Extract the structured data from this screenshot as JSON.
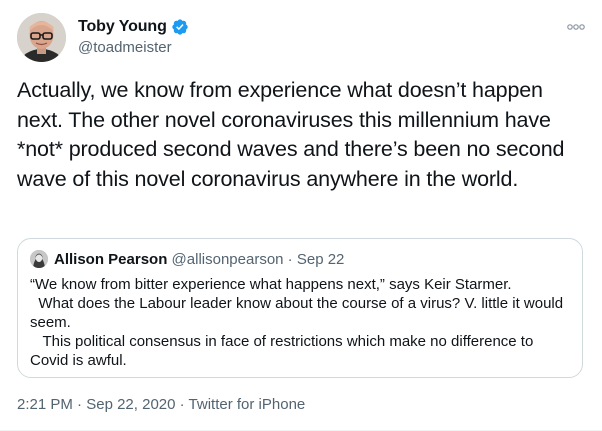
{
  "author": {
    "display_name": "Toby Young",
    "handle": "@toadmeister",
    "verified": true
  },
  "tweet": {
    "text": "Actually, we know from experience what doesn’t happen next. The other novel coronaviruses this millennium have *not* produced second waves and there’s been no second wave of this novel coronavirus anywhere in the world.",
    "time": "2:21 PM",
    "separator": " · ",
    "date": "Sep 22, 2020",
    "source": "Twitter for iPhone"
  },
  "quoted_tweet": {
    "display_name": "Allison Pearson",
    "handle": "@allisonpearson",
    "separator": " · ",
    "date": "Sep 22",
    "text": "“We know from bitter experience what happens next,” says Keir Starmer.\n  What does the Labour leader know about the course of a virus? V. little it would seem.\n   This political consensus in face of restrictions which make no difference to Covid is awful."
  },
  "icons": {
    "verified": "verified-badge-icon",
    "more": "more-options-icon"
  },
  "colors": {
    "verified_blue": "#1d9bf0",
    "secondary_text": "#536471",
    "border": "#cfd9de"
  }
}
